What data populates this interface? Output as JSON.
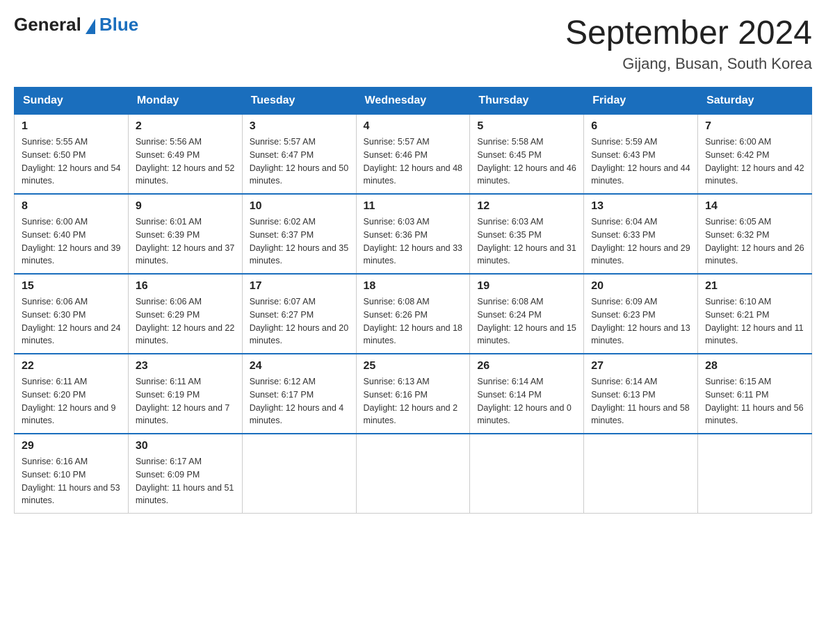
{
  "logo": {
    "general": "General",
    "blue": "Blue"
  },
  "header": {
    "title": "September 2024",
    "subtitle": "Gijang, Busan, South Korea"
  },
  "weekdays": [
    "Sunday",
    "Monday",
    "Tuesday",
    "Wednesday",
    "Thursday",
    "Friday",
    "Saturday"
  ],
  "weeks": [
    [
      {
        "day": "1",
        "sunrise": "5:55 AM",
        "sunset": "6:50 PM",
        "daylight": "12 hours and 54 minutes."
      },
      {
        "day": "2",
        "sunrise": "5:56 AM",
        "sunset": "6:49 PM",
        "daylight": "12 hours and 52 minutes."
      },
      {
        "day": "3",
        "sunrise": "5:57 AM",
        "sunset": "6:47 PM",
        "daylight": "12 hours and 50 minutes."
      },
      {
        "day": "4",
        "sunrise": "5:57 AM",
        "sunset": "6:46 PM",
        "daylight": "12 hours and 48 minutes."
      },
      {
        "day": "5",
        "sunrise": "5:58 AM",
        "sunset": "6:45 PM",
        "daylight": "12 hours and 46 minutes."
      },
      {
        "day": "6",
        "sunrise": "5:59 AM",
        "sunset": "6:43 PM",
        "daylight": "12 hours and 44 minutes."
      },
      {
        "day": "7",
        "sunrise": "6:00 AM",
        "sunset": "6:42 PM",
        "daylight": "12 hours and 42 minutes."
      }
    ],
    [
      {
        "day": "8",
        "sunrise": "6:00 AM",
        "sunset": "6:40 PM",
        "daylight": "12 hours and 39 minutes."
      },
      {
        "day": "9",
        "sunrise": "6:01 AM",
        "sunset": "6:39 PM",
        "daylight": "12 hours and 37 minutes."
      },
      {
        "day": "10",
        "sunrise": "6:02 AM",
        "sunset": "6:37 PM",
        "daylight": "12 hours and 35 minutes."
      },
      {
        "day": "11",
        "sunrise": "6:03 AM",
        "sunset": "6:36 PM",
        "daylight": "12 hours and 33 minutes."
      },
      {
        "day": "12",
        "sunrise": "6:03 AM",
        "sunset": "6:35 PM",
        "daylight": "12 hours and 31 minutes."
      },
      {
        "day": "13",
        "sunrise": "6:04 AM",
        "sunset": "6:33 PM",
        "daylight": "12 hours and 29 minutes."
      },
      {
        "day": "14",
        "sunrise": "6:05 AM",
        "sunset": "6:32 PM",
        "daylight": "12 hours and 26 minutes."
      }
    ],
    [
      {
        "day": "15",
        "sunrise": "6:06 AM",
        "sunset": "6:30 PM",
        "daylight": "12 hours and 24 minutes."
      },
      {
        "day": "16",
        "sunrise": "6:06 AM",
        "sunset": "6:29 PM",
        "daylight": "12 hours and 22 minutes."
      },
      {
        "day": "17",
        "sunrise": "6:07 AM",
        "sunset": "6:27 PM",
        "daylight": "12 hours and 20 minutes."
      },
      {
        "day": "18",
        "sunrise": "6:08 AM",
        "sunset": "6:26 PM",
        "daylight": "12 hours and 18 minutes."
      },
      {
        "day": "19",
        "sunrise": "6:08 AM",
        "sunset": "6:24 PM",
        "daylight": "12 hours and 15 minutes."
      },
      {
        "day": "20",
        "sunrise": "6:09 AM",
        "sunset": "6:23 PM",
        "daylight": "12 hours and 13 minutes."
      },
      {
        "day": "21",
        "sunrise": "6:10 AM",
        "sunset": "6:21 PM",
        "daylight": "12 hours and 11 minutes."
      }
    ],
    [
      {
        "day": "22",
        "sunrise": "6:11 AM",
        "sunset": "6:20 PM",
        "daylight": "12 hours and 9 minutes."
      },
      {
        "day": "23",
        "sunrise": "6:11 AM",
        "sunset": "6:19 PM",
        "daylight": "12 hours and 7 minutes."
      },
      {
        "day": "24",
        "sunrise": "6:12 AM",
        "sunset": "6:17 PM",
        "daylight": "12 hours and 4 minutes."
      },
      {
        "day": "25",
        "sunrise": "6:13 AM",
        "sunset": "6:16 PM",
        "daylight": "12 hours and 2 minutes."
      },
      {
        "day": "26",
        "sunrise": "6:14 AM",
        "sunset": "6:14 PM",
        "daylight": "12 hours and 0 minutes."
      },
      {
        "day": "27",
        "sunrise": "6:14 AM",
        "sunset": "6:13 PM",
        "daylight": "11 hours and 58 minutes."
      },
      {
        "day": "28",
        "sunrise": "6:15 AM",
        "sunset": "6:11 PM",
        "daylight": "11 hours and 56 minutes."
      }
    ],
    [
      {
        "day": "29",
        "sunrise": "6:16 AM",
        "sunset": "6:10 PM",
        "daylight": "11 hours and 53 minutes."
      },
      {
        "day": "30",
        "sunrise": "6:17 AM",
        "sunset": "6:09 PM",
        "daylight": "11 hours and 51 minutes."
      },
      null,
      null,
      null,
      null,
      null
    ]
  ]
}
